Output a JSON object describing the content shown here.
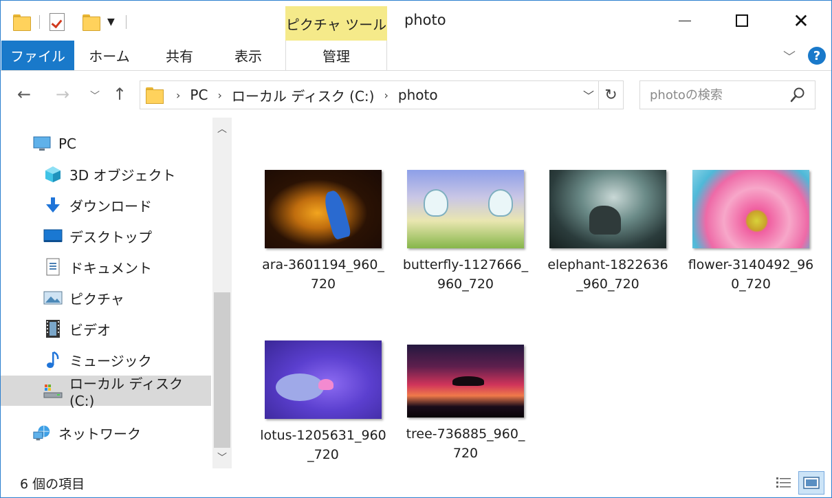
{
  "titlebar": {
    "context_tab_title": "ピクチャ ツール",
    "window_title": "photo",
    "minimize_icon": "minimize-icon",
    "maximize_icon": "maximize-icon",
    "close_glyph": "✕"
  },
  "ribbon": {
    "tabs": {
      "file": "ファイル",
      "home": "ホーム",
      "share": "共有",
      "view": "表示",
      "manage": "管理"
    },
    "expand_glyph": "﹀",
    "help_glyph": "?",
    "accent_color": "#1979ca",
    "context_color": "#f5ea8a"
  },
  "address": {
    "back_glyph": "←",
    "forward_glyph": "→",
    "recent_glyph": "﹀",
    "up_glyph": "↑",
    "crumbs": [
      "PC",
      "ローカル ディスク (C:)",
      "photo"
    ],
    "crumb_sep": "›",
    "dropdown_glyph": "﹀",
    "refresh_glyph": "↻"
  },
  "search": {
    "placeholder": "photoの検索"
  },
  "navpane": {
    "items": [
      {
        "label": "PC",
        "icon": "pc-icon"
      },
      {
        "label": "3D オブジェクト",
        "icon": "3d-objects-icon"
      },
      {
        "label": "ダウンロード",
        "icon": "download-icon"
      },
      {
        "label": "デスクトップ",
        "icon": "desktop-icon"
      },
      {
        "label": "ドキュメント",
        "icon": "documents-icon"
      },
      {
        "label": "ピクチャ",
        "icon": "pictures-icon"
      },
      {
        "label": "ビデオ",
        "icon": "videos-icon"
      },
      {
        "label": "ミュージック",
        "icon": "music-icon"
      },
      {
        "label": "ローカル ディスク (C:)",
        "icon": "local-disk-icon"
      },
      {
        "label": "ネットワーク",
        "icon": "network-icon"
      }
    ],
    "selected": "ローカル ディスク (C:)",
    "scroll_up_glyph": "︿",
    "scroll_down_glyph": "﹀"
  },
  "files": [
    {
      "name": "ara-3601194_960_720"
    },
    {
      "name": "butterfly-1127666_960_720"
    },
    {
      "name": "elephant-1822636_960_720"
    },
    {
      "name": "flower-3140492_960_720"
    },
    {
      "name": "lotus-1205631_960_720"
    },
    {
      "name": "tree-736885_960_720"
    }
  ],
  "status": {
    "count": "6 個の項目"
  }
}
